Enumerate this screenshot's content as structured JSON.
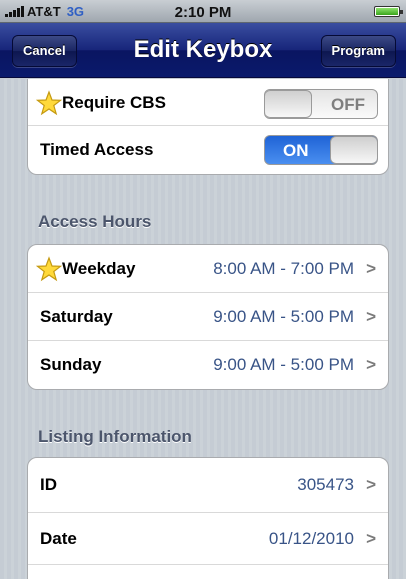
{
  "status_bar": {
    "carrier": "AT&T",
    "network": "3G",
    "time": "2:10 PM"
  },
  "nav": {
    "title": "Edit Keybox",
    "cancel_label": "Cancel",
    "program_label": "Program"
  },
  "settings": {
    "require_cbs": {
      "label": "Require CBS",
      "switch_text": "OFF",
      "on": false
    },
    "timed_access": {
      "label": "Timed Access",
      "switch_text": "ON",
      "on": true
    }
  },
  "access_hours": {
    "header": "Access Hours",
    "rows": [
      {
        "label": "Weekday",
        "value": "8:00 AM - 7:00 PM",
        "starred": true
      },
      {
        "label": "Saturday",
        "value": "9:00 AM - 5:00 PM",
        "starred": false
      },
      {
        "label": "Sunday",
        "value": "9:00 AM - 5:00 PM",
        "starred": false
      }
    ]
  },
  "listing_information": {
    "header": "Listing Information",
    "rows": [
      {
        "label": "ID",
        "value": "305473"
      },
      {
        "label": "Date",
        "value": "01/12/2010"
      }
    ]
  },
  "chevron": ">",
  "colors": {
    "nav_bar": "#0a1a6c",
    "value_text": "#395487",
    "switch_on": "#2f6fe0",
    "section_header": "#4c566c"
  },
  "icons": {
    "star": "star-icon",
    "chevron": "chevron-right-icon",
    "signal": "signal-bars-icon",
    "battery": "battery-icon"
  }
}
